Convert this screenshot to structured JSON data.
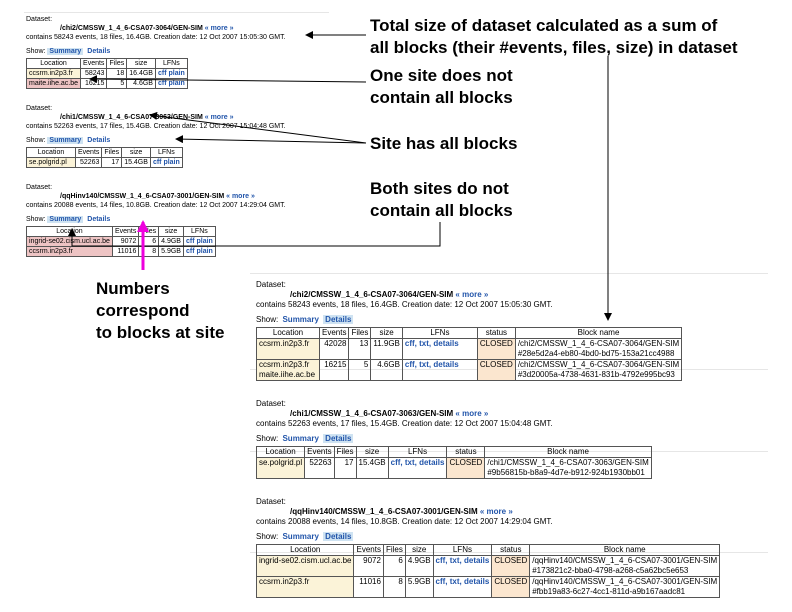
{
  "small": {
    "datasets": [
      {
        "label": "Dataset:",
        "name": "/chi2/CMSSW_1_4_6-CSA07-3064/GEN-SIM",
        "more": "« more »",
        "summary": "contains 58243 events, 18 files, 16.4GB. Creation date: 12 Oct 2007 15:05:30 GMT.",
        "show": "Show:",
        "tab_summary": "Summary",
        "tab_details": "Details",
        "headers": [
          "Location",
          "Events",
          "Files",
          "size",
          "LFNs"
        ],
        "rows": [
          {
            "location": "ccsrm.in2p3.fr",
            "events": "58243",
            "files": "18",
            "size": "16.4GB",
            "lfns": "cff plain",
            "status": "ok"
          },
          {
            "location": "maite.iihe.ac.be",
            "events": "16215",
            "files": "5",
            "size": "4.6GB",
            "lfns": "cff plain",
            "status": "bad"
          }
        ]
      },
      {
        "label": "Dataset:",
        "name": "/chi1/CMSSW_1_4_6-CSA07-3063/GEN-SIM",
        "more": "« more »",
        "summary": "contains 52263 events, 17 files, 15.4GB. Creation date: 12 Oct 2007 15:04:48 GMT.",
        "show": "Show:",
        "tab_summary": "Summary",
        "tab_details": "Details",
        "headers": [
          "Location",
          "Events",
          "Files",
          "size",
          "LFNs"
        ],
        "rows": [
          {
            "location": "se.polgrid.pl",
            "events": "52263",
            "files": "17",
            "size": "15.4GB",
            "lfns": "cff plain",
            "status": "ok"
          }
        ]
      },
      {
        "label": "Dataset:",
        "name": "/qqHinv140/CMSSW_1_4_6-CSA07-3001/GEN-SIM",
        "more": "« more »",
        "summary": "contains 20088 events, 14 files, 10.8GB. Creation date: 12 Oct 2007 14:29:04 GMT.",
        "show": "Show:",
        "tab_summary": "Summary",
        "tab_details": "Details",
        "headers": [
          "Location",
          "Events",
          "Files",
          "size",
          "LFNs"
        ],
        "rows": [
          {
            "location": "ingrid-se02.cism.ucl.ac.be",
            "events": "9072",
            "files": "6",
            "size": "4.9GB",
            "lfns": "cff plain",
            "status": "bad"
          },
          {
            "location": "ccsrm.in2p3.fr",
            "events": "11016",
            "files": "8",
            "size": "5.9GB",
            "lfns": "cff plain",
            "status": "bad"
          }
        ]
      }
    ]
  },
  "big": {
    "datasets": [
      {
        "label": "Dataset:",
        "name": "/chi2/CMSSW_1_4_6-CSA07-3064/GEN-SIM",
        "more": "« more »",
        "summary": "contains 58243 events, 18 files, 16.4GB. Creation date: 12 Oct 2007 15:05:30 GMT.",
        "show": "Show:",
        "tab_summary": "Summary",
        "tab_details": "Details",
        "headers": [
          "Location",
          "Events",
          "Files",
          "size",
          "LFNs",
          "status",
          "Block name"
        ],
        "rows": [
          {
            "location": "ccsrm.in2p3.fr",
            "events": "42028",
            "files": "13",
            "size": "11.9GB",
            "lfns": "cff, txt, details",
            "state": "CLOSED",
            "block1": "/chi2/CMSSW_1_4_6-CSA07-3064/GEN-SIM",
            "block2": "#28e5d2a4-eb80-4bd0-bd75-153a21cc4988"
          },
          {
            "location": "ccsrm.in2p3.fr",
            "location2": "maite.iihe.ac.be",
            "events": "16215",
            "files": "5",
            "size": "4.6GB",
            "lfns": "cff, txt, details",
            "state": "CLOSED",
            "block1": "/chi2/CMSSW_1_4_6-CSA07-3064/GEN-SIM",
            "block2": "#3d20005a-4738-4631-831b-4792e995bc93"
          }
        ]
      },
      {
        "label": "Dataset:",
        "name": "/chi1/CMSSW_1_4_6-CSA07-3063/GEN-SIM",
        "more": "« more »",
        "summary": "contains 52263 events, 17 files, 15.4GB. Creation date: 12 Oct 2007 15:04:48 GMT.",
        "show": "Show:",
        "tab_summary": "Summary",
        "tab_details": "Details",
        "headers": [
          "Location",
          "Events",
          "Files",
          "size",
          "LFNs",
          "status",
          "Block name"
        ],
        "rows": [
          {
            "location": "se.polgrid.pl",
            "events": "52263",
            "files": "17",
            "size": "15.4GB",
            "lfns": "cff, txt, details",
            "state": "CLOSED",
            "block1": "/chi1/CMSSW_1_4_6-CSA07-3063/GEN-SIM",
            "block2": "#9b56815b-b8a9-4d7e-b912-924b1930bb01"
          }
        ]
      },
      {
        "label": "Dataset:",
        "name": "/qqHinv140/CMSSW_1_4_6-CSA07-3001/GEN-SIM",
        "more": "« more »",
        "summary": "contains 20088 events, 14 files, 10.8GB. Creation date: 12 Oct 2007 14:29:04 GMT.",
        "show": "Show:",
        "tab_summary": "Summary",
        "tab_details": "Details",
        "headers": [
          "Location",
          "Events",
          "Files",
          "size",
          "LFNs",
          "status",
          "Block name"
        ],
        "rows": [
          {
            "location": "ingrid-se02.cism.ucl.ac.be",
            "events": "9072",
            "files": "6",
            "size": "4.9GB",
            "lfns": "cff, txt, details",
            "state": "CLOSED",
            "block1": "/qqHinv140/CMSSW_1_4_6-CSA07-3001/GEN-SIM",
            "block2": "#173821c2-bba0-4798-a268-c5a62bc5e653"
          },
          {
            "location": "ccsrm.in2p3.fr",
            "events": "11016",
            "files": "8",
            "size": "5.9GB",
            "lfns": "cff, txt, details",
            "state": "CLOSED",
            "block1": "/qqHinv140/CMSSW_1_4_6-CSA07-3001/GEN-SIM",
            "block2": "#fbb19a83-6c27-4cc1-811d-a9b167aadc81"
          }
        ]
      }
    ]
  },
  "notes": {
    "total_size_1": "Total size of dataset calculated as a sum of",
    "total_size_2": "all blocks (their #events, files, size) in dataset",
    "one_site_1": "One site does not",
    "one_site_2": "contain all blocks",
    "has_all": "Site has all blocks",
    "both_sites_1": "Both sites do not",
    "both_sites_2": "contain all blocks",
    "numbers_1": "Numbers",
    "numbers_2": "correspond",
    "numbers_3": "to blocks at site"
  },
  "colors": {
    "link": "#2255aa",
    "missing_site": "#eec4c4",
    "complete_site": "#fbf3d8",
    "closed": "#fbe6cf",
    "magenta_arrow": "#ee00dd"
  }
}
